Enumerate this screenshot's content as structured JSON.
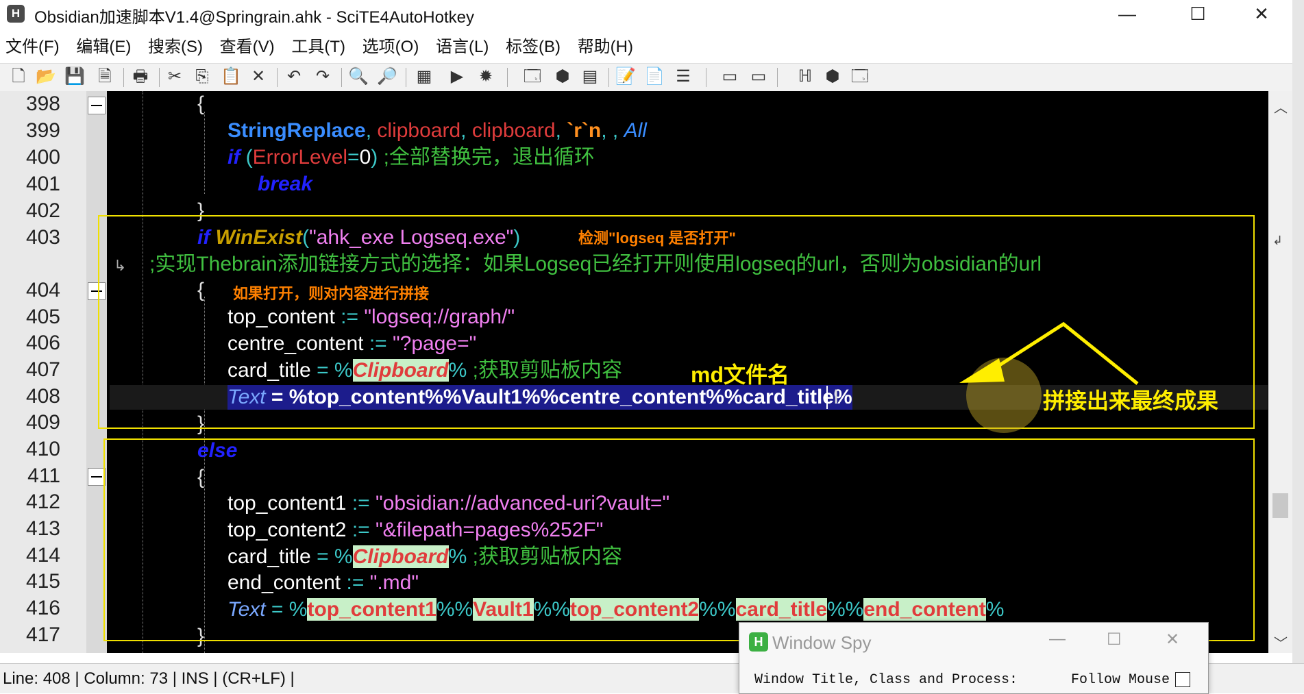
{
  "window": {
    "title": "Obsidian加速脚本V1.4@Springrain.ahk - SciTE4AutoHotkey",
    "app_icon_letter": "H",
    "minimize": "—",
    "maximize": "☐",
    "close": "✕"
  },
  "menu": [
    "文件(F)",
    "编辑(E)",
    "搜索(S)",
    "查看(V)",
    "工具(T)",
    "选项(O)",
    "语言(L)",
    "标签(B)",
    "帮助(H)"
  ],
  "line_numbers": [
    "398",
    "399",
    "400",
    "401",
    "402",
    "403",
    "404",
    "405",
    "406",
    "407",
    "408",
    "409",
    "410",
    "411",
    "412",
    "413",
    "414",
    "415",
    "416",
    "417"
  ],
  "code": {
    "l398": "{",
    "l399_fn": "StringReplace",
    "l399_a": ", ",
    "l399_v1": "clipboard",
    "l399_b": ", ",
    "l399_v2": "clipboard",
    "l399_c": ", ",
    "l399_esc": "`r`n",
    "l399_d": ", , ",
    "l399_all": "All",
    "l400_kw": "if",
    "l400_p1": " (",
    "l400_v": "ErrorLevel",
    "l400_eq": "=",
    "l400_n": "0",
    "l400_p2": ") ",
    "l400_cmt": ";全部替换完，退出循环",
    "l401_kw": "break",
    "l402": "}",
    "l403_kw": "if",
    "l403_fn": "WinExist",
    "l403_p1": "(",
    "l403_str": "\"ahk_exe Logseq.exe\"",
    "l403_p2": ")",
    "l403_wrap_cmt": ";实现Thebrain添加链接方式的选择：如果Logseq已经打开则使用logseq的url，否则为obsidian的url",
    "l404": "{",
    "l405_var": "top_content",
    "l405_op": "     :=",
    "l405_str": " \"logseq://graph/\"",
    "l406_var": "centre_content",
    "l406_op": " :=",
    "l406_str": " \"?page=\"",
    "l407_var": "card_title",
    "l407_op": " = %",
    "l407_clip": "Clipboard",
    "l407_op2": "% ",
    "l407_cmt": ";获取剪贴板内容",
    "l408_text": "Text",
    "l408_expr": " = %top_content%%Vault1%%centre_content%%card_title%",
    "l409": "}",
    "l410_kw": "else",
    "l411": "{",
    "l412_var": "top_content1",
    "l412_op": " :=",
    "l412_str": " \"obsidian://advanced-uri?vault=\"",
    "l413_var": "top_content2",
    "l413_op": " :=",
    "l413_str": " \"&filepath=pages%252F\"",
    "l414_var": "card_title",
    "l414_op": " = %",
    "l414_clip": "Clipboard",
    "l414_op2": "% ",
    "l414_cmt": ";获取剪贴板内容",
    "l415_var": "end_content",
    "l415_op": " :=",
    "l415_str": " \".md\"",
    "l416_text": "Text",
    "l416_eq": " = %",
    "l416_v1": "top_content1",
    "l416_s1": "%%",
    "l416_v2": "Vault1",
    "l416_s2": "%%",
    "l416_v3": "top_content2",
    "l416_s3": "%%",
    "l416_v4": "card_title",
    "l416_s4": "%%",
    "l416_v5": "end_content",
    "l416_s5": "%",
    "l417": "}"
  },
  "annotations": {
    "detect": "检测\"logseq 是否打开\"",
    "if_open": "如果打开，则对内容进行拼接",
    "md_name": "md文件名",
    "result": "拼接出来最终成果"
  },
  "status": "Line: 408 | Column: 73 | INS | (CR+LF) |",
  "window_spy": {
    "title": "Window Spy",
    "icon_letter": "H",
    "label": "Window Title, Class and Process:",
    "follow": "Follow Mouse"
  },
  "colors": {
    "editor_bg": "#000000",
    "keyword": "#2222ff",
    "function": "#3a8dff",
    "variable": "#e03c3c",
    "string": "#f080f0",
    "comment": "#40c040",
    "annotation_box": "#f0e000"
  }
}
